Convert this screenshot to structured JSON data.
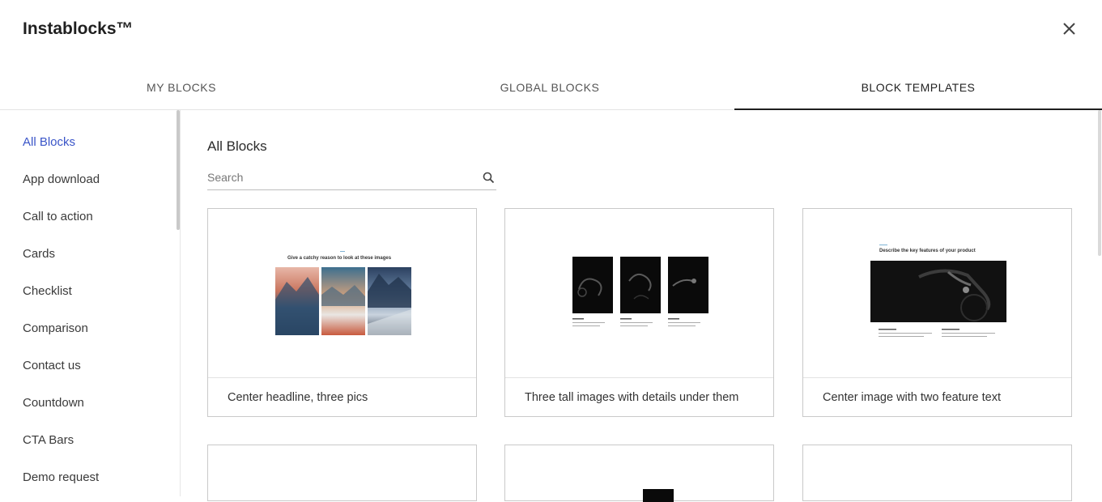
{
  "header": {
    "title": "Instablocks™"
  },
  "tabs": [
    {
      "label": "MY BLOCKS"
    },
    {
      "label": "GLOBAL BLOCKS"
    },
    {
      "label": "BLOCK TEMPLATES"
    }
  ],
  "active_tab": "BLOCK TEMPLATES",
  "sidebar": {
    "items": [
      {
        "label": "All Blocks"
      },
      {
        "label": "App download"
      },
      {
        "label": "Call to action"
      },
      {
        "label": "Cards"
      },
      {
        "label": "Checklist"
      },
      {
        "label": "Comparison"
      },
      {
        "label": "Contact us"
      },
      {
        "label": "Countdown"
      },
      {
        "label": "CTA Bars"
      },
      {
        "label": "Demo request"
      }
    ],
    "active": "All Blocks"
  },
  "main": {
    "title": "All Blocks",
    "search": {
      "placeholder": "Search",
      "value": ""
    },
    "cards": [
      {
        "label": "Center headline, three pics",
        "preview_headline": "Give a catchy reason to look at these images"
      },
      {
        "label": "Three tall images with details under them"
      },
      {
        "label": "Center image with two feature text",
        "preview_headline": "Describe the key features of your product"
      }
    ]
  },
  "colors": {
    "accent": "#3a55c8",
    "tab_underline": "#1f1f1f",
    "border": "#c9c9c9"
  }
}
